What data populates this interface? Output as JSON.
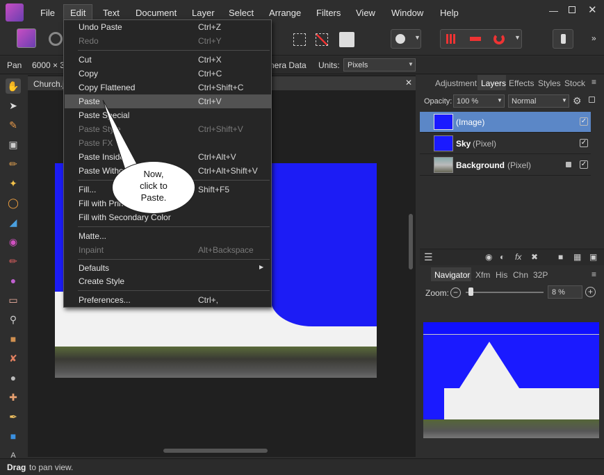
{
  "menubar": {
    "items": [
      "File",
      "Edit",
      "Text",
      "Document",
      "Layer",
      "Select",
      "Arrange",
      "Filters",
      "View",
      "Window",
      "Help"
    ]
  },
  "context": {
    "tool": "Pan",
    "size": "6000 × 3",
    "camera": "nera Data",
    "units_label": "Units:",
    "units_value": "Pixels"
  },
  "document": {
    "tab": "Church.jp"
  },
  "edit_menu": {
    "undo_paste": {
      "label": "Undo Paste",
      "shortcut": "Ctrl+Z"
    },
    "redo": {
      "label": "Redo",
      "shortcut": "Ctrl+Y"
    },
    "cut": {
      "label": "Cut",
      "shortcut": "Ctrl+X"
    },
    "copy": {
      "label": "Copy",
      "shortcut": "Ctrl+C"
    },
    "copy_flattened": {
      "label": "Copy Flattened",
      "shortcut": "Ctrl+Shift+C"
    },
    "paste": {
      "label": "Paste",
      "shortcut": "Ctrl+V"
    },
    "paste_special": {
      "label": "Paste Special"
    },
    "paste_style": {
      "label": "Paste Style",
      "shortcut": "Ctrl+Shift+V"
    },
    "paste_fx": {
      "label": "Paste FX"
    },
    "paste_inside": {
      "label": "Paste Inside",
      "shortcut": "Ctrl+Alt+V"
    },
    "paste_without": {
      "label": "Paste Without",
      "shortcut": "Ctrl+Alt+Shift+V"
    },
    "fill": {
      "label": "Fill...",
      "shortcut": "Shift+F5"
    },
    "fill_primary": {
      "label": "Fill with Primary Color"
    },
    "fill_secondary": {
      "label": "Fill with Secondary Color"
    },
    "matte": {
      "label": "Matte..."
    },
    "inpaint": {
      "label": "Inpaint",
      "shortcut": "Alt+Backspace"
    },
    "defaults": {
      "label": "Defaults"
    },
    "create_style": {
      "label": "Create Style"
    },
    "preferences": {
      "label": "Preferences...",
      "shortcut": "Ctrl+,"
    }
  },
  "callout": {
    "line1": "Now,",
    "line2": "click to",
    "line3": "Paste."
  },
  "panel": {
    "tabs": [
      "Adjustment",
      "Layers",
      "Effects",
      "Styles",
      "Stock"
    ],
    "opacity_label": "Opacity:",
    "opacity_value": "100 %",
    "blend": "Normal",
    "layers": [
      {
        "name": "(Image)",
        "type": ""
      },
      {
        "name": "Sky",
        "type": "(Pixel)"
      },
      {
        "name": "Background",
        "type": "(Pixel)"
      }
    ]
  },
  "navigator": {
    "tabs": [
      "Navigator",
      "Xfm",
      "His",
      "Chn",
      "32P"
    ],
    "zoom_label": "Zoom:",
    "zoom_value": "8 %"
  },
  "status": {
    "bold": "Drag",
    "text": "to pan view."
  },
  "colors": {
    "accent": "#5b87c7",
    "sky": "#1a1aff",
    "menu_bg": "#262626",
    "highlight": "#525252"
  }
}
